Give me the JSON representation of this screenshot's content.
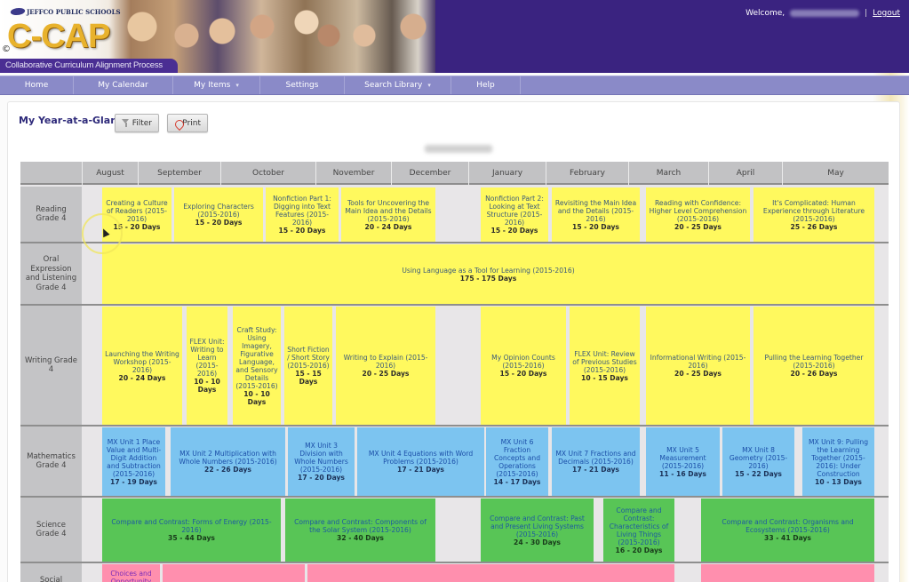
{
  "header": {
    "org_name": "JEFFCO PUBLIC SCHOOLS",
    "app_name": "C-CAP",
    "copyright_symbol": "©",
    "tagline": "Collaborative Curriculum Alignment Process",
    "welcome_label": "Welcome,",
    "separator": "|",
    "logout_label": "Logout"
  },
  "nav": {
    "items": [
      {
        "label": "Home",
        "has_dropdown": false
      },
      {
        "label": "My Calendar",
        "has_dropdown": false
      },
      {
        "label": "My Items",
        "has_dropdown": true
      },
      {
        "label": "Settings",
        "has_dropdown": false
      },
      {
        "label": "Search Library",
        "has_dropdown": true
      },
      {
        "label": "Help",
        "has_dropdown": false
      }
    ],
    "caret": "▾"
  },
  "page": {
    "title": "My Year-at-a-Glance",
    "filter_label": "Filter",
    "print_label": "Print",
    "date_range": "8/2015 - 5/2016"
  },
  "calendar": {
    "months": [
      "August",
      "September",
      "October",
      "November",
      "December",
      "January",
      "February",
      "March",
      "April",
      "May"
    ],
    "rows": [
      {
        "label": "Reading Grade 4",
        "color": "yellow",
        "units": [
          {
            "title": "Creating a Culture of Readers (2015-2016)",
            "days": "15 - 20 Days"
          },
          {
            "title": "Exploring Characters (2015-2016)",
            "days": "15 - 20 Days"
          },
          {
            "title": "Nonfiction Part 1: Digging into Text Features (2015-2016)",
            "days": "15 - 20 Days"
          },
          {
            "title": "Tools for Uncovering the Main Idea and the Details (2015-2016)",
            "days": "20 - 24 Days"
          },
          {
            "title": "Nonfiction Part 2: Looking at Text Structure (2015-2016)",
            "days": "15 - 20 Days"
          },
          {
            "title": "Revisiting the Main Idea and the Details (2015-2016)",
            "days": "15 - 20 Days"
          },
          {
            "title": "Reading with Confidence: Higher Level Comprehension (2015-2016)",
            "days": "20 - 25 Days"
          },
          {
            "title": "It's Complicated: Human Experience through Literature (2015-2016)",
            "days": "25 - 26 Days"
          }
        ]
      },
      {
        "label": "Oral Expression and Listening Grade 4",
        "color": "yellow",
        "units": [
          {
            "title": "Using Language as a Tool for Learning (2015-2016)",
            "days": "175 - 175 Days"
          }
        ]
      },
      {
        "label": "Writing Grade 4",
        "color": "yellow",
        "units": [
          {
            "title": "Launching the Writing Workshop (2015-2016)",
            "days": "20 - 24 Days"
          },
          {
            "title": "FLEX Unit: Writing to Learn (2015-2016)",
            "days": "10 - 10 Days"
          },
          {
            "title": "Craft Study: Using Imagery, Figurative Language, and Sensory Details (2015-2016)",
            "days": "10 - 10 Days"
          },
          {
            "title": "Short Fiction / Short Story (2015-2016)",
            "days": "15 - 15 Days"
          },
          {
            "title": "Writing to Explain (2015-2016)",
            "days": "20 - 25 Days"
          },
          {
            "title": "My Opinion Counts (2015-2016)",
            "days": "15 - 20 Days"
          },
          {
            "title": "FLEX Unit: Review of Previous Studies (2015-2016)",
            "days": "10 - 15 Days"
          },
          {
            "title": "Informational Writing (2015-2016)",
            "days": "20 - 25 Days"
          },
          {
            "title": "Pulling the Learning Together (2015-2016)",
            "days": "20 - 26 Days"
          }
        ]
      },
      {
        "label": "Mathematics Grade 4",
        "color": "blue",
        "units": [
          {
            "title": "MX Unit 1 Place Value and Multi-Digit Addition and Subtraction (2015-2016)",
            "days": "17 - 19 Days"
          },
          {
            "title": "MX Unit 2 Multiplication with Whole Numbers (2015-2016)",
            "days": "22 - 26 Days"
          },
          {
            "title": "MX Unit 3 Division with Whole Numbers (2015-2016)",
            "days": "17 - 20 Days"
          },
          {
            "title": "MX Unit 4 Equations with Word Problems (2015-2016)",
            "days": "17 - 21 Days"
          },
          {
            "title": "MX Unit 6 Fraction Concepts and Operations (2015-2016)",
            "days": "14 - 17 Days"
          },
          {
            "title": "MX Unit 7 Fractions and Decimals (2015-2016)",
            "days": "17 - 21 Days"
          },
          {
            "title": "MX Unit 5 Measurement (2015-2016)",
            "days": "11 - 16 Days"
          },
          {
            "title": "MX Unit 8 Geometry (2015-2016)",
            "days": "15 - 22 Days"
          },
          {
            "title": "MX Unit 9: Pulling the Learning Together (2015-2016): Under Construction",
            "days": "10 - 13 Days"
          }
        ]
      },
      {
        "label": "Science Grade 4",
        "color": "green",
        "units": [
          {
            "title": "Compare and Contrast: Forms of Energy (2015-2016)",
            "days": "35 - 44 Days"
          },
          {
            "title": "Compare and Contrast: Components of the Solar System (2015-2016)",
            "days": "32 - 40 Days"
          },
          {
            "title": "Compare and Contrast: Past and Present Living Systems (2015-2016)",
            "days": "24 - 30 Days"
          },
          {
            "title": "Compare and Contrast: Characteristics of Living Things (2015-2016)",
            "days": "16 - 20 Days"
          },
          {
            "title": "Compare and Contrast: Organisms and Ecosystems (2015-2016)",
            "days": "33 - 41 Days"
          }
        ]
      },
      {
        "label": "Social",
        "color": "pink",
        "units": [
          {
            "title": "Choices and Opportunity",
            "days": ""
          },
          {
            "title": "",
            "days": ""
          },
          {
            "title": "",
            "days": ""
          },
          {
            "title": "",
            "days": ""
          }
        ]
      }
    ]
  },
  "colors": {
    "header_bg": "#3a2380",
    "nav_bg": "#8a8ac8",
    "title_color": "#2e2a7a",
    "yellow": "#fff95e",
    "blue": "#7cc4f0",
    "green": "#58c556",
    "pink": "#ff8fae"
  }
}
